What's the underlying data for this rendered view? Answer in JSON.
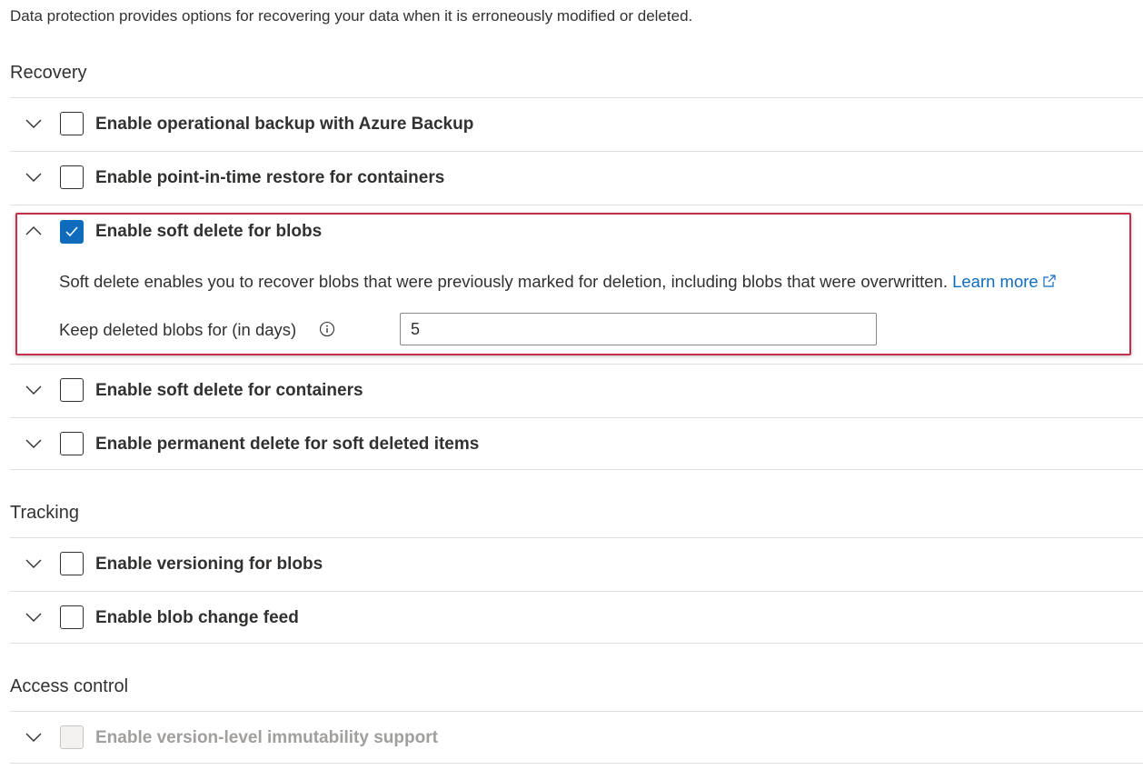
{
  "intro_text": "Data protection provides options for recovering your data when it is erroneously modified or deleted.",
  "sections": {
    "recovery": {
      "title": "Recovery",
      "items": [
        {
          "label": "Enable operational backup with Azure Backup",
          "checked": false,
          "expanded": false
        },
        {
          "label": "Enable point-in-time restore for containers",
          "checked": false,
          "expanded": false
        },
        {
          "label": "Enable soft delete for blobs",
          "checked": true,
          "expanded": true
        },
        {
          "label": "Enable soft delete for containers",
          "checked": false,
          "expanded": false
        },
        {
          "label": "Enable permanent delete for soft deleted items",
          "checked": false,
          "expanded": false
        }
      ]
    },
    "tracking": {
      "title": "Tracking",
      "items": [
        {
          "label": "Enable versioning for blobs",
          "checked": false,
          "expanded": false
        },
        {
          "label": "Enable blob change feed",
          "checked": false,
          "expanded": false
        }
      ]
    },
    "access_control": {
      "title": "Access control",
      "items": [
        {
          "label": "Enable version-level immutability support",
          "checked": false,
          "expanded": false,
          "disabled": true
        }
      ]
    }
  },
  "soft_delete_blobs": {
    "description": "Soft delete enables you to recover blobs that were previously marked for deletion, including blobs that were overwritten.",
    "learn_more": "Learn more",
    "retention_label": "Keep deleted blobs for (in days)",
    "retention_value": "5"
  },
  "icons": {
    "expand": "chevron-down-icon",
    "collapse": "chevron-up-icon",
    "checkmark": "checkmark-icon",
    "info": "info-icon",
    "external_link": "external-link-icon"
  },
  "colors": {
    "accent": "#0f6cbd",
    "highlight_border": "#c4314b",
    "divider": "#e1dfdd",
    "text": "#323130",
    "disabled_text": "#a19f9d"
  }
}
